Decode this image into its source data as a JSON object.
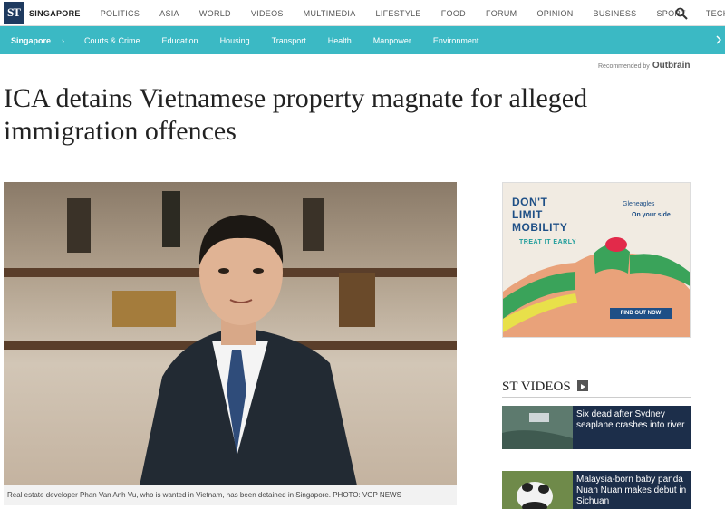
{
  "header": {
    "logo_text": "ST",
    "nav": [
      "SINGAPORE",
      "POLITICS",
      "ASIA",
      "WORLD",
      "VIDEOS",
      "MULTIMEDIA",
      "LIFESTYLE",
      "FOOD",
      "FORUM",
      "OPINION",
      "BUSINESS",
      "SPORT",
      "TECH"
    ],
    "active_nav": "SINGAPORE"
  },
  "subnav": {
    "section": "Singapore",
    "items": [
      "Courts & Crime",
      "Education",
      "Housing",
      "Transport",
      "Health",
      "Manpower",
      "Environment"
    ]
  },
  "recommended": {
    "label": "Recommended by",
    "brand": "Outbrain"
  },
  "article": {
    "headline": "ICA detains Vietnamese property magnate for alleged immigration offences",
    "caption": "Real estate developer Phan Van Anh Vu, who is wanted in Vietnam, has been detained in Singapore. PHOTO: VGP NEWS"
  },
  "ad": {
    "headline_1": "DON'T",
    "headline_2": "LIMIT",
    "headline_3": "MOBILITY",
    "subline": "TREAT IT EARLY",
    "brand": "Gleneagles",
    "tagline": "On your side",
    "cta": "FIND OUT NOW"
  },
  "videos": {
    "title": "ST VIDEOS",
    "items": [
      {
        "title": "Six dead after Sydney seaplane crashes into river"
      },
      {
        "title": "Malaysia-born baby panda Nuan Nuan makes debut in Sichuan"
      }
    ]
  },
  "colors": {
    "accent": "#3bb9c4",
    "navy": "#1c2e4a"
  }
}
